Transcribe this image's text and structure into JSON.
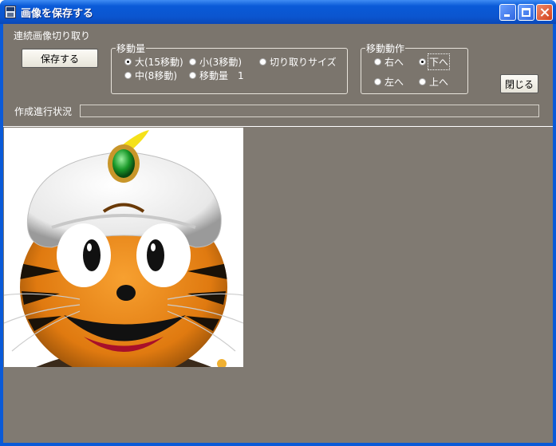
{
  "window": {
    "title": "画像を保存する"
  },
  "section_label": "連続画像切り取り",
  "save_button": "保存する",
  "move_amount": {
    "legend": "移動量",
    "options": [
      {
        "label": "大(15移動)",
        "selected": true
      },
      {
        "label": "小(3移動)",
        "selected": false
      },
      {
        "label": "切り取りサイズ",
        "selected": false
      },
      {
        "label": "中(8移動)",
        "selected": false
      },
      {
        "label": "移動量　1",
        "selected": false
      }
    ]
  },
  "move_action": {
    "legend": "移動動作",
    "options": [
      {
        "label": "右へ",
        "selected": false
      },
      {
        "label": "下へ",
        "selected": true
      },
      {
        "label": "左へ",
        "selected": false
      },
      {
        "label": "上へ",
        "selected": false
      }
    ]
  },
  "close_button": "閉じる",
  "progress": {
    "label": "作成進行状況",
    "value": 0
  }
}
